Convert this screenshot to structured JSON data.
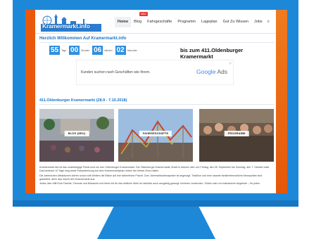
{
  "header": {
    "logo_text": "Kramermarkt.info",
    "nav": [
      "Home",
      "Blog",
      "Fahrgeschäfte",
      "Programm",
      "Lageplan",
      "Gut Zu Wissen",
      "Jobs"
    ],
    "nav_badge": "NEU",
    "active_index": 0
  },
  "welcome": "Herzlich Willkommen Auf Kramermarkt.info",
  "countdown": {
    "days": "55",
    "days_label": "Tage",
    "hours": "00",
    "hours_label": "Stunden",
    "minutes": "06",
    "minutes_label": "Minuten",
    "seconds": "02",
    "seconds_label": "Sekunden",
    "title": "bis zum 411.Oldenburger Kramermarkt"
  },
  "ad": {
    "text": "Kunden suchen nach Geschäften wie Ihrem.",
    "brand_google": "Google",
    "brand_ads": "Ads",
    "choices": "▷"
  },
  "section_title": "411.Oldenburger Kramermarkt (28.9 - 7.10.2018)",
  "cards": [
    {
      "label": "BLOG (NEU)"
    },
    {
      "label": "FAHRGESCHÄFTE"
    },
    {
      "label": "PROGRAMM"
    }
  ],
  "body_text": [
    "Kramermarkt.info ist das unabhängige Portal rund um den Oldenburger Kramermarkt. Der Oldenburger Kramermarkt, findet in diesem Jahr von Freitag, den 28. September bis Sonntag, den 7. Oktober statt. Das bedeutet 10 Tage lang beste Partystimmung auf dem Kramermarktplatz neben der Weser-Ems-Hallen.",
    "Die zahlreichen Attraktionen ziehen schon seit Weitem die Blicke auf ihre farbenfrohe Pracht. Zum Jahrmarktsatmosphäre ist angesagt. Tradition und eine rasante familienfreundliche Atmosphäre sind garantiert, denn das macht den Kramermarkt aus.",
    "Jedes Jahr trifft Eure Familie, Freunde und Bekannte und feiert mit für das leibliche Wohl ist natürlich auch ausgiebig gesorgt: leckeres Leckereien, Süßes oder zur kulinarische Angebote – für jeden"
  ],
  "colors": {
    "monitor": "#1e88d8",
    "accent": "#1a73c9",
    "countdown_box": "#2f8fe0",
    "orange": "#e8590c"
  }
}
